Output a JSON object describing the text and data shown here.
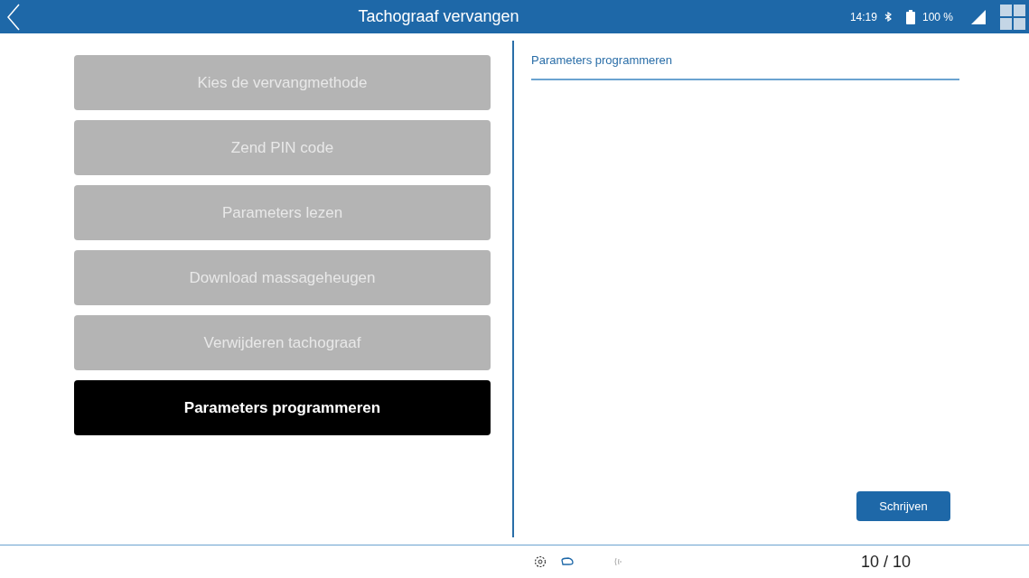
{
  "window": {
    "title": "Tachograaf vervangen"
  },
  "status": {
    "time": "14:19",
    "battery": "100 %"
  },
  "steps": [
    {
      "label": "Kies de vervangmethode",
      "selected": false
    },
    {
      "label": "Zend PIN code",
      "selected": false
    },
    {
      "label": "Parameters lezen",
      "selected": false
    },
    {
      "label": "Download massageheugen",
      "selected": false
    },
    {
      "label": "Verwijderen tachograaf",
      "selected": false
    },
    {
      "label": "Parameters programmeren",
      "selected": true
    }
  ],
  "panel": {
    "title": "Parameters programmeren",
    "button": "Schrijven"
  },
  "footer": {
    "page": "10 / 10"
  }
}
